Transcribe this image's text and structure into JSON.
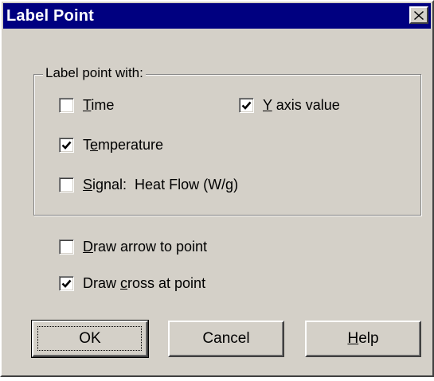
{
  "window": {
    "title": "Label Point",
    "close_glyph": "✕"
  },
  "group": {
    "legend": "Label point with:"
  },
  "options": {
    "time": {
      "pre": "",
      "accel": "T",
      "post": "ime",
      "checked": false
    },
    "y_axis": {
      "pre": "",
      "accel": "Y",
      "post": " axis value",
      "checked": true
    },
    "temperature": {
      "pre": "T",
      "accel": "e",
      "post": "mperature",
      "checked": true
    },
    "signal": {
      "pre": "",
      "accel": "S",
      "post": "ignal:  Heat Flow (W/g)",
      "checked": false
    },
    "draw_arrow": {
      "pre": "",
      "accel": "D",
      "post": "raw arrow to point",
      "checked": false
    },
    "draw_cross": {
      "pre": "Draw ",
      "accel": "c",
      "post": "ross at point",
      "checked": true
    }
  },
  "buttons": {
    "ok": "OK",
    "cancel": "Cancel",
    "help_accel": "H",
    "help_rest": "elp"
  },
  "colors": {
    "titlebar": "#000080",
    "face": "#d4d0c8"
  },
  "icons": {
    "close": "close-icon",
    "check": "checkmark-icon"
  }
}
